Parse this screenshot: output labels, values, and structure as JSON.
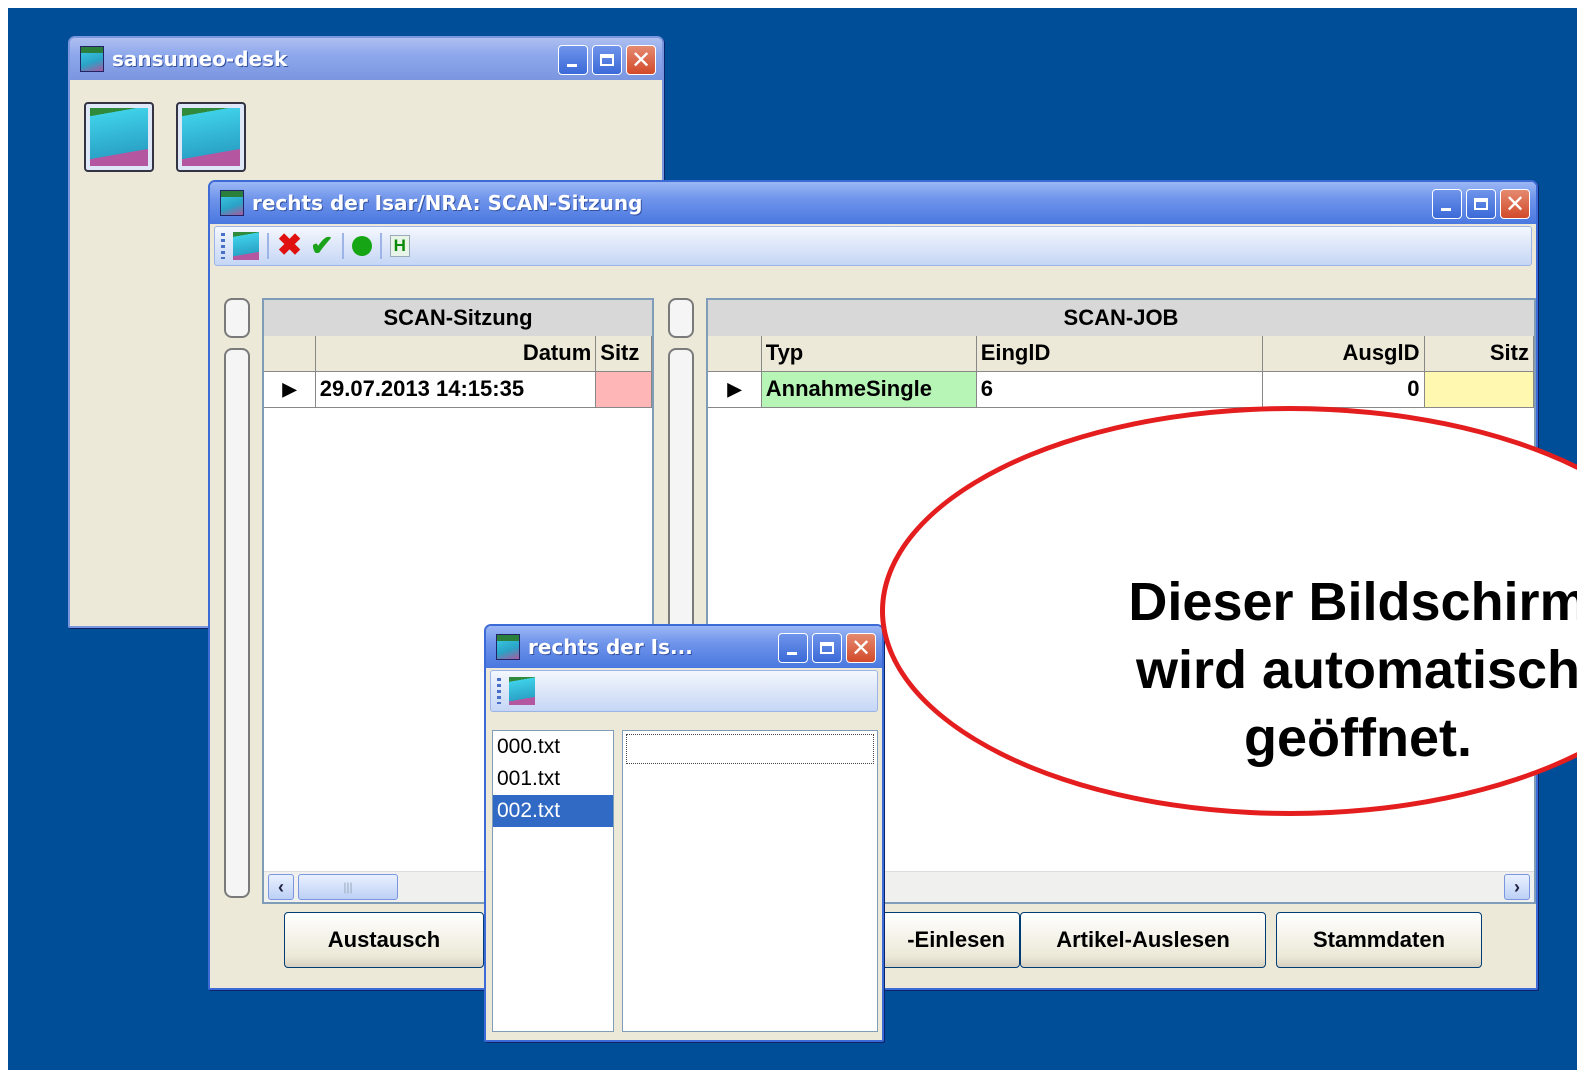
{
  "desk_window": {
    "title": "sansumeo-desk"
  },
  "main_window": {
    "title": "rechts der Isar/NRA: SCAN-Sitzung",
    "left_grid": {
      "title": "SCAN-Sitzung",
      "columns": [
        "Datum",
        "Sitz"
      ],
      "row": {
        "datum": "29.07.2013 14:15:35",
        "sitz": ""
      }
    },
    "right_grid": {
      "title": "SCAN-JOB",
      "columns": [
        "Typ",
        "EinglD",
        "AusglD",
        "Sitz"
      ],
      "row": {
        "typ": "AnnahmeSingle",
        "eingid": "6",
        "ausgid": "0",
        "sitz": ""
      }
    },
    "buttons": [
      "Austausch",
      "-Einlesen",
      "Artikel-Auslesen",
      "Stammdaten"
    ]
  },
  "file_window": {
    "title": "rechts der Is...",
    "files": [
      "000.txt",
      "001.txt",
      "002.txt"
    ],
    "selected": "002.txt"
  },
  "callout": {
    "text": "Dieser Bildschirm\nwird automatisch\ngeöffnet."
  },
  "colors": {
    "desktop": "#004e98",
    "callout_border": "#e41e1e",
    "row_highlight_pink": "#ffb6b6",
    "row_highlight_green": "#b6f5b6",
    "row_highlight_yellow": "#fff8b0",
    "selection": "#316ac5"
  },
  "icons": [
    "app-icon",
    "close-red-x-icon",
    "check-green-icon",
    "green-dot-icon",
    "h-icon",
    "minimize-icon",
    "maximize-icon",
    "close-icon",
    "scroll-left-icon",
    "scroll-right-icon",
    "row-indicator-icon"
  ]
}
